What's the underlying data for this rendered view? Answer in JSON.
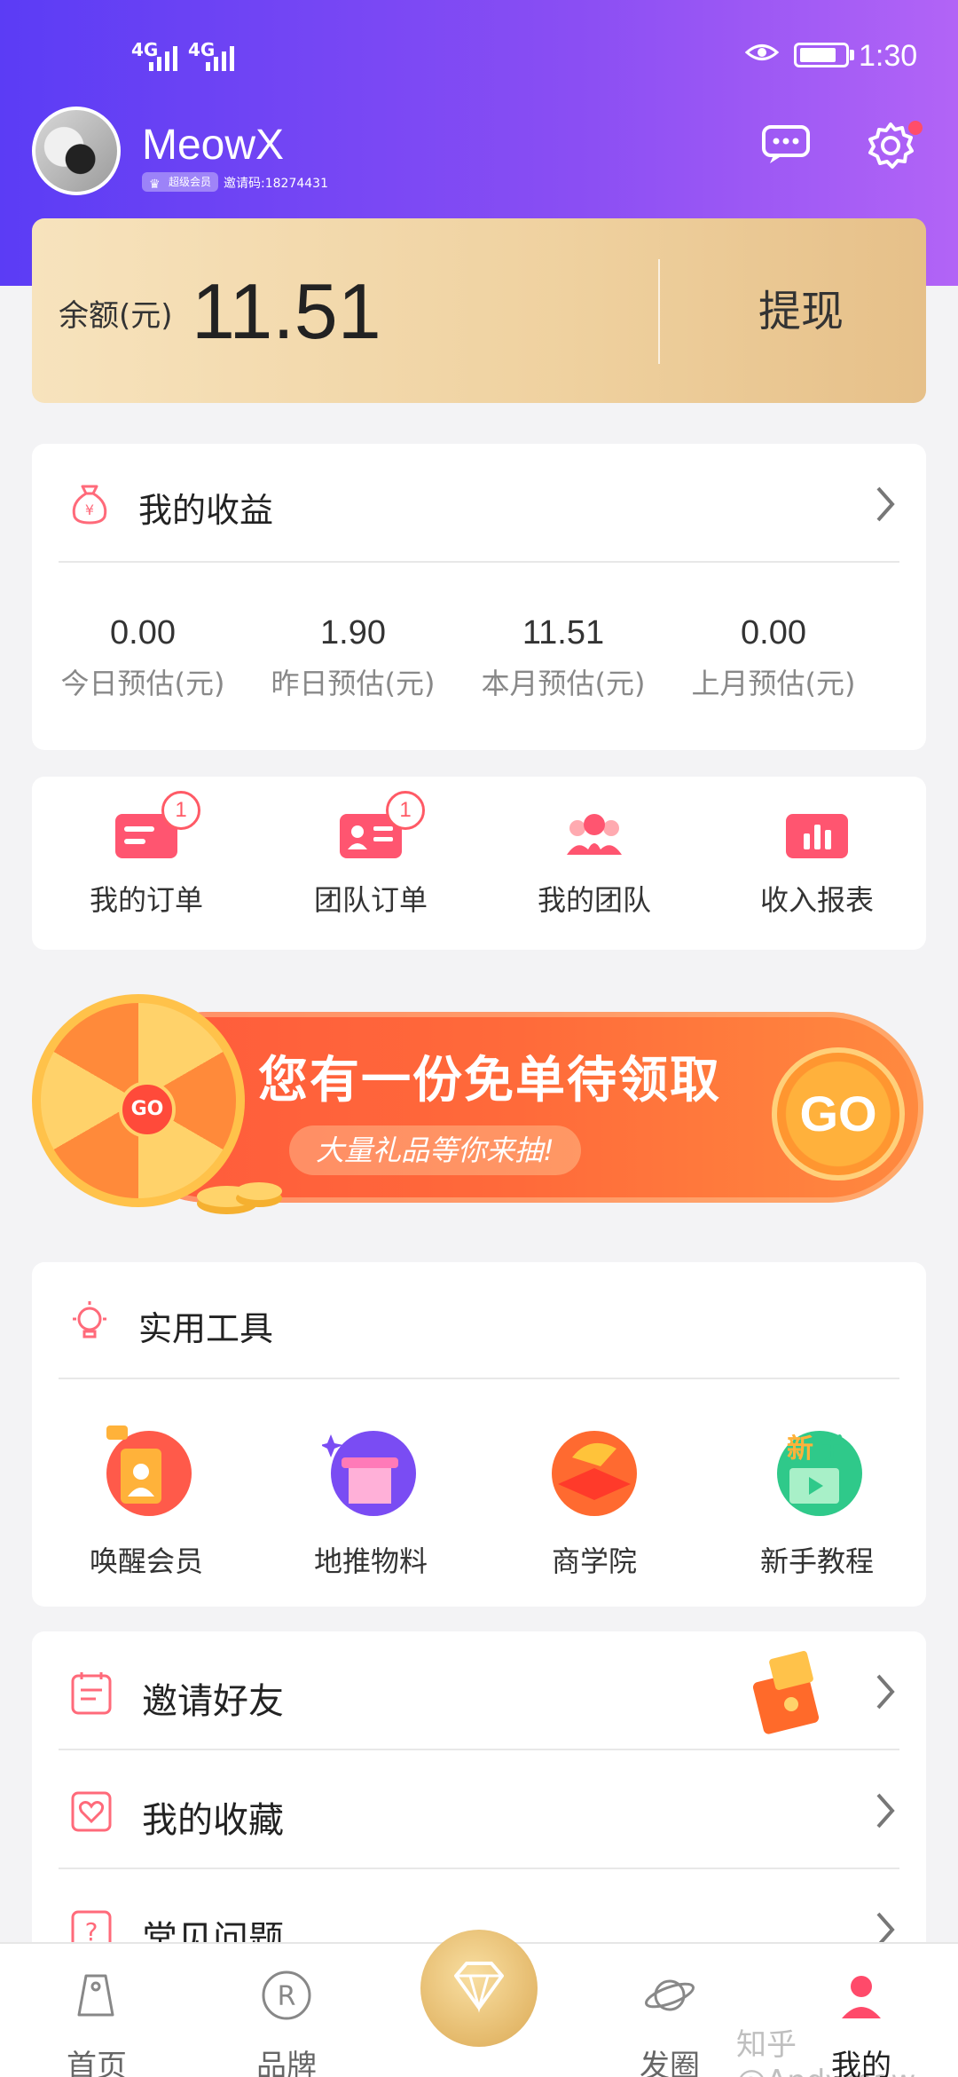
{
  "status_bar": {
    "signal1": "4G",
    "signal2": "4G",
    "time": "1:30"
  },
  "profile": {
    "username": "MeowX",
    "vip_label": "超级会员",
    "invite_code": "邀请码:18274431"
  },
  "balance": {
    "label": "余额(元)",
    "value": "11.51",
    "withdraw_label": "提现"
  },
  "earnings": {
    "title": "我的收益",
    "stats": [
      {
        "value": "0.00",
        "label": "今日预估(元)"
      },
      {
        "value": "1.90",
        "label": "昨日预估(元)"
      },
      {
        "value": "11.51",
        "label": "本月预估(元)"
      },
      {
        "value": "0.00",
        "label": "上月预估(元)"
      }
    ]
  },
  "orders": {
    "items": [
      {
        "label": "我的订单",
        "badge": "1"
      },
      {
        "label": "团队订单",
        "badge": "1"
      },
      {
        "label": "我的团队"
      },
      {
        "label": "收入报表"
      }
    ]
  },
  "banner": {
    "title": "您有一份免单待领取",
    "subtitle": "大量礼品等你来抽!",
    "go_label": "GO",
    "wheel_go": "GO"
  },
  "tools": {
    "title": "实用工具",
    "items": [
      {
        "label": "唤醒会员"
      },
      {
        "label": "地推物料"
      },
      {
        "label": "商学院"
      },
      {
        "label": "新手教程"
      }
    ]
  },
  "list": {
    "items": [
      {
        "label": "邀请好友"
      },
      {
        "label": "我的收藏"
      },
      {
        "label": "常见问题"
      }
    ]
  },
  "bottom_nav": {
    "items": [
      {
        "label": "首页"
      },
      {
        "label": "品牌"
      },
      {
        "label": "发圈"
      },
      {
        "label": "我的"
      }
    ]
  },
  "watermark": "知乎 @Andymaw",
  "colors": {
    "header_start": "#5b3cf5",
    "header_end": "#b264f6",
    "accent_red": "#ff5a66",
    "gold": "#efd19f"
  }
}
